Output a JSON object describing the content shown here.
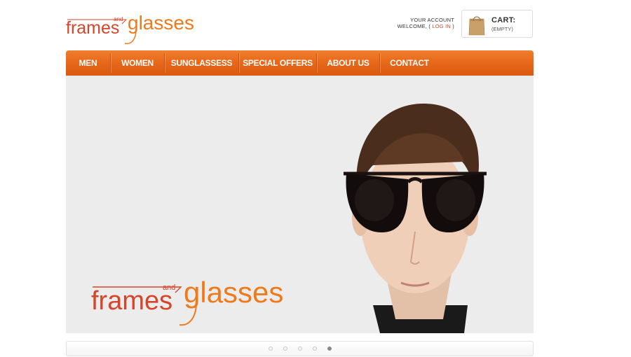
{
  "brand": {
    "word1": "frames",
    "word2": "and",
    "word3": "glasses",
    "color_primary": "#d6452a",
    "color_secondary": "#ee7a1c"
  },
  "account": {
    "line1": "YOUR ACCOUNT",
    "welcome": "WELCOME, (",
    "login": "LOG IN",
    "close": ")"
  },
  "cart": {
    "title": "CART:",
    "status": "(EMPTY)",
    "icon": "shopping-bag-icon"
  },
  "nav": {
    "items": [
      {
        "label": "MEN"
      },
      {
        "label": "WOMEN"
      },
      {
        "label": "SUNGLASSESS"
      },
      {
        "label": "SPECIAL OFFERS"
      },
      {
        "label": "ABOUT US"
      },
      {
        "label": "CONTACT"
      }
    ],
    "color": "#e8691a"
  },
  "slider": {
    "total_slides": 5,
    "active_slide": 5
  }
}
